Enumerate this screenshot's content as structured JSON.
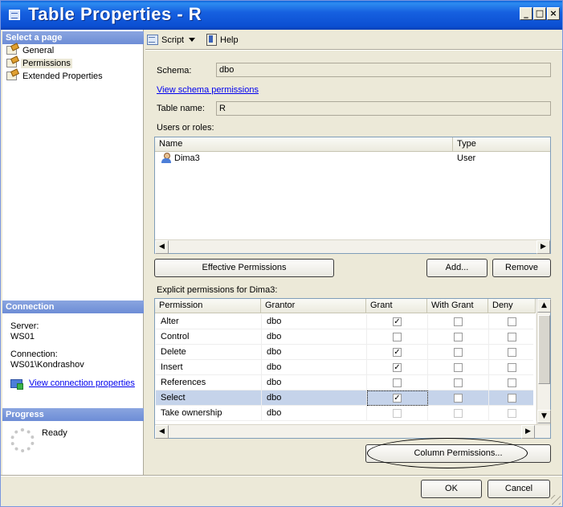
{
  "window": {
    "title": "Table Properties - R",
    "controls": {
      "minimize": "_",
      "maximize": "□",
      "close": "×"
    }
  },
  "left_pane": {
    "select_page_header": "Select a page",
    "pages": [
      {
        "label": "General",
        "icon": "page-wrench-icon",
        "selected": false
      },
      {
        "label": "Permissions",
        "icon": "page-wrench-icon",
        "selected": true
      },
      {
        "label": "Extended Properties",
        "icon": "page-wrench-icon",
        "selected": false
      }
    ],
    "connection_header": "Connection",
    "server_label": "Server:",
    "server_value": "WS01",
    "connection_label": "Connection:",
    "connection_value": "WS01\\Kondrashov",
    "view_connection_link": "View connection properties",
    "progress_header": "Progress",
    "progress_status": "Ready"
  },
  "toolbar": {
    "script_label": "Script",
    "help_label": "Help"
  },
  "form": {
    "schema_label": "Schema:",
    "schema_value": "dbo",
    "view_schema_link": "View schema permissions",
    "table_name_label": "Table name:",
    "table_name_value": "R",
    "users_roles_label": "Users or roles:"
  },
  "users_grid": {
    "columns": [
      "Name",
      "Type"
    ],
    "rows": [
      {
        "name": "Dima3",
        "type": "User"
      }
    ]
  },
  "buttons": {
    "effective_permissions": "Effective Permissions",
    "add": "Add...",
    "remove": "Remove",
    "column_permissions": "Column Permissions...",
    "ok": "OK",
    "cancel": "Cancel"
  },
  "explicit": {
    "label": "Explicit permissions for Dima3:",
    "columns": [
      "Permission",
      "Grantor",
      "Grant",
      "With Grant",
      "Deny"
    ],
    "rows": [
      {
        "permission": "Alter",
        "grantor": "dbo",
        "grant": true,
        "with_grant": false,
        "deny": false
      },
      {
        "permission": "Control",
        "grantor": "dbo",
        "grant": false,
        "with_grant": false,
        "deny": false
      },
      {
        "permission": "Delete",
        "grantor": "dbo",
        "grant": true,
        "with_grant": false,
        "deny": false
      },
      {
        "permission": "Insert",
        "grantor": "dbo",
        "grant": true,
        "with_grant": false,
        "deny": false
      },
      {
        "permission": "References",
        "grantor": "dbo",
        "grant": false,
        "with_grant": false,
        "deny": false
      },
      {
        "permission": "Select",
        "grantor": "dbo",
        "grant": true,
        "with_grant": false,
        "deny": false,
        "selected": true
      },
      {
        "permission": "Take ownership",
        "grantor": "dbo",
        "grant": false,
        "with_grant": false,
        "deny": false,
        "disabled": true
      }
    ]
  },
  "colors": {
    "title_bar": "#0b4fd2",
    "section_header": "#7896dc",
    "link": "#0000ee",
    "selection": "#c5d3ea",
    "dialog_face": "#ece9d8"
  }
}
